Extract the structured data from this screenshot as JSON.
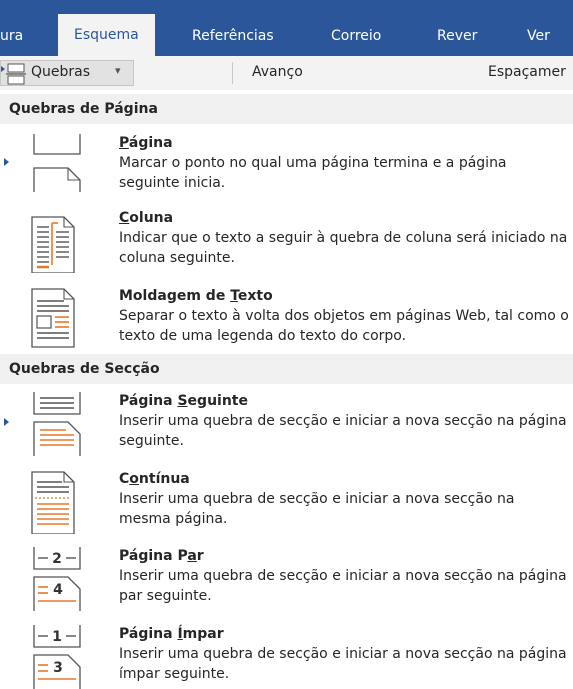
{
  "ribbon": {
    "tabs": [
      "ura",
      "Esquema",
      "Referências",
      "Correio",
      "Rever",
      "Ver"
    ],
    "active_tab": "Esquema"
  },
  "toolbar": {
    "breaks_label": "Quebras",
    "breaks_arrow": "▾",
    "advance_label": "Avanço",
    "spacing_label": "Espaçamer"
  },
  "sections": {
    "page_breaks": "Quebras de Página",
    "section_breaks": "Quebras de Secção"
  },
  "items": {
    "pagina": {
      "title_pre": "",
      "title_ul": "P",
      "title_post": "ágina",
      "desc": "Marcar o ponto no qual uma página termina e a página seguinte inicia."
    },
    "coluna": {
      "title_pre": "",
      "title_ul": "C",
      "title_post": "oluna",
      "desc": "Indicar que o texto a seguir à quebra de coluna será iniciado na coluna seguinte."
    },
    "moldagem": {
      "title_pre": "Moldagem de ",
      "title_ul": "T",
      "title_post": "exto",
      "desc": "Separar o texto à volta dos objetos em páginas Web, tal como o texto de uma legenda do texto do corpo."
    },
    "pagina_seguinte": {
      "title_pre": "Página ",
      "title_ul": "S",
      "title_post": "eguinte",
      "desc": "Inserir uma quebra de secção e iniciar a nova secção na página seguinte."
    },
    "continua": {
      "title_pre": "C",
      "title_ul": "o",
      "title_post": "ntínua",
      "desc": "Inserir uma quebra de secção e iniciar a nova secção na mesma página."
    },
    "pagina_par": {
      "title_pre": "Página P",
      "title_ul": "a",
      "title_post": "r",
      "desc": "Inserir uma quebra de secção e iniciar a nova secção na página par seguinte."
    },
    "pagina_impar": {
      "title_pre": "Página ",
      "title_ul": "Í",
      "title_post": "mpar",
      "desc": "Inserir uma quebra de secção e iniciar a nova secção na página ímpar seguinte."
    }
  },
  "icon_numbers": {
    "even_top": "2",
    "even_bottom": "4",
    "odd_top": "1",
    "odd_bottom": "3"
  },
  "colors": {
    "ribbon": "#2b579a",
    "accent_orange": "#e8782a",
    "header_bg": "#f0f0f0"
  }
}
